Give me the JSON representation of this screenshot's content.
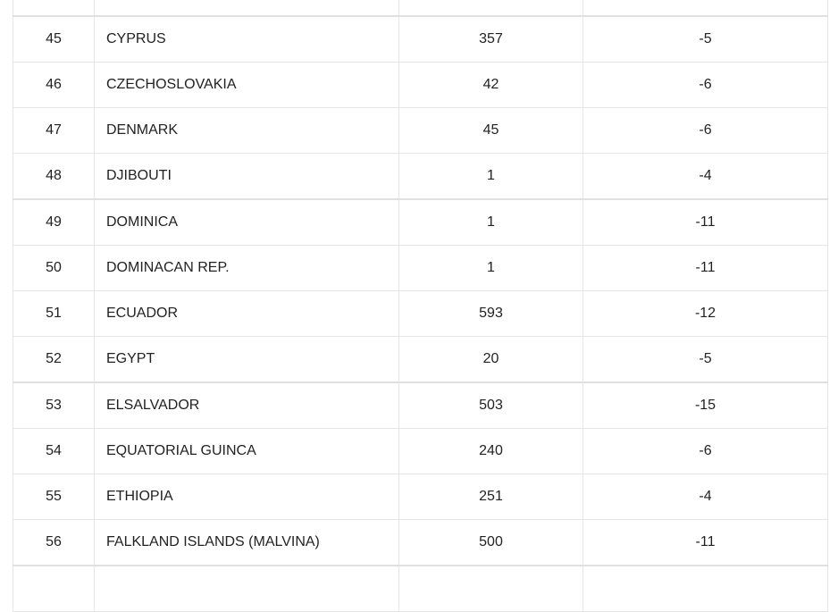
{
  "table": {
    "rows": [
      {
        "no": "",
        "country": "",
        "value": "",
        "change": ""
      },
      {
        "no": "45",
        "country": "CYPRUS",
        "value": "357",
        "change": "-5"
      },
      {
        "no": "46",
        "country": "CZECHOSLOVAKIA",
        "value": "42",
        "change": "-6"
      },
      {
        "no": "47",
        "country": "DENMARK",
        "value": "45",
        "change": "-6"
      },
      {
        "no": "48",
        "country": "DJIBOUTI",
        "value": "1",
        "change": "-4"
      },
      {
        "no": "49",
        "country": "DOMINICA",
        "value": "1",
        "change": "-11"
      },
      {
        "no": "50",
        "country": "DOMINACAN REP.",
        "value": "1",
        "change": "-11"
      },
      {
        "no": "51",
        "country": "ECUADOR",
        "value": "593",
        "change": "-12"
      },
      {
        "no": "52",
        "country": "EGYPT",
        "value": "20",
        "change": "-5"
      },
      {
        "no": "53",
        "country": "ELSALVADOR",
        "value": "503",
        "change": "-15"
      },
      {
        "no": "54",
        "country": "EQUATORIAL GUINCA",
        "value": "240",
        "change": "-6"
      },
      {
        "no": "55",
        "country": "ETHIOPIA",
        "value": "251",
        "change": "-4"
      },
      {
        "no": "56",
        "country": "FALKLAND ISLANDS (MALVINA)",
        "value": "500",
        "change": "-11"
      },
      {
        "no": "",
        "country": "",
        "value": "",
        "change": ""
      }
    ]
  }
}
